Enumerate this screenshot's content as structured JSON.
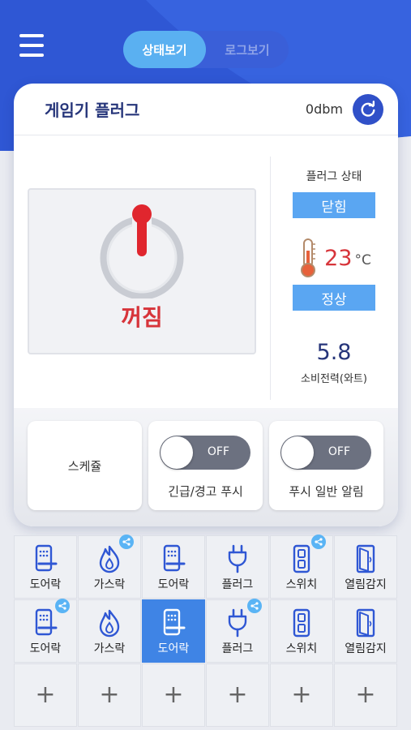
{
  "header": {
    "tabs": [
      {
        "label": "상태보기",
        "active": true
      },
      {
        "label": "로그보기",
        "active": false
      }
    ],
    "menu_icon": "hamburger-menu-icon",
    "accent_color": "#3a5fd8"
  },
  "device": {
    "title": "게임기 플러그",
    "signal": "0dbm",
    "refresh_icon": "refresh-icon",
    "power_state_label": "꺼짐",
    "power_icon": "power-icon",
    "plug_status_label": "플러그 상태",
    "plug_status_value": "닫힘",
    "temperature": "23",
    "temperature_unit": "°C",
    "temperature_icon": "thermometer-icon",
    "temperature_status": "정상",
    "power_consumption": "5.8",
    "power_consumption_label": "소비전력(와트)"
  },
  "controls": {
    "schedule_label": "스케쥴",
    "emergency_push_label": "긴급/경고 푸시",
    "emergency_push_state": "OFF",
    "normal_push_label": "푸시 일반 알림",
    "normal_push_state": "OFF"
  },
  "grid": {
    "row1": [
      {
        "label": "도어락",
        "icon": "doorlock-icon",
        "shared": false
      },
      {
        "label": "가스락",
        "icon": "gaslock-icon",
        "shared": true
      },
      {
        "label": "도어락",
        "icon": "doorlock-icon",
        "shared": false
      },
      {
        "label": "플러그",
        "icon": "plug-icon",
        "shared": false
      },
      {
        "label": "스위치",
        "icon": "switch-icon",
        "shared": true
      },
      {
        "label": "열림감지",
        "icon": "door-sensor-icon",
        "shared": false
      }
    ],
    "row2": [
      {
        "label": "도어락",
        "icon": "doorlock-icon",
        "shared": true
      },
      {
        "label": "가스락",
        "icon": "gaslock-icon",
        "shared": false
      },
      {
        "label": "도어락",
        "icon": "doorlock-icon",
        "shared": false,
        "selected": true
      },
      {
        "label": "플러그",
        "icon": "plug-icon",
        "shared": true
      },
      {
        "label": "스위치",
        "icon": "switch-icon",
        "shared": false
      },
      {
        "label": "열림감지",
        "icon": "door-sensor-icon",
        "shared": false
      }
    ],
    "add_label": "+"
  }
}
